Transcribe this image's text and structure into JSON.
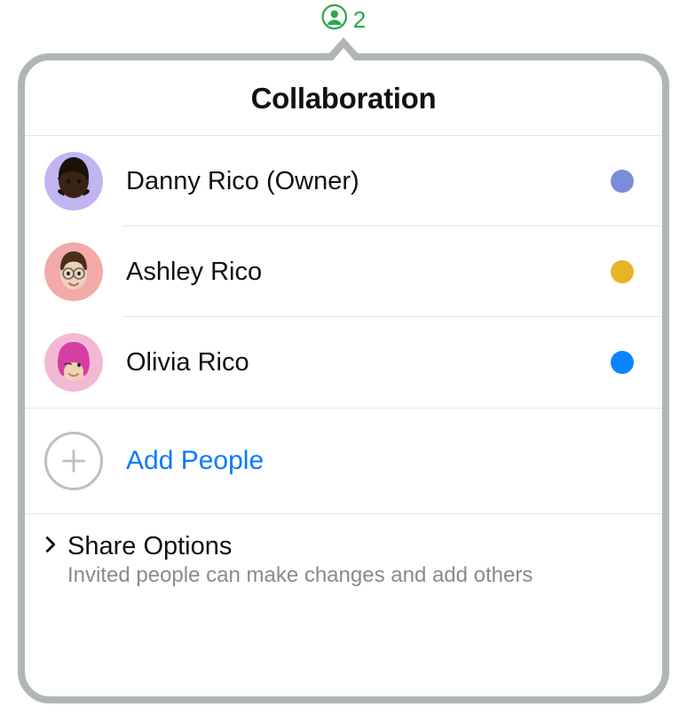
{
  "badge": {
    "count": "2"
  },
  "popover": {
    "title": "Collaboration"
  },
  "collaborators": [
    {
      "name": "Danny Rico (Owner)",
      "avatar_bg": "#c0b5f2",
      "avatar_tone": "#3a2314",
      "avatar_hair": "#1a1209",
      "dot_color": "#7a8dd9"
    },
    {
      "name": "Ashley Rico",
      "avatar_bg": "#f2a9a9",
      "avatar_tone": "#edd2b8",
      "avatar_hair": "#4a2f1a",
      "dot_color": "#e8b325"
    },
    {
      "name": "Olivia Rico",
      "avatar_bg": "#f2b8d4",
      "avatar_tone": "#edd2b8",
      "avatar_hair": "#d63fa2",
      "dot_color": "#0a84ff"
    }
  ],
  "add_people": {
    "label": "Add People"
  },
  "share_options": {
    "title": "Share Options",
    "subtitle": "Invited people can make changes and add others"
  }
}
